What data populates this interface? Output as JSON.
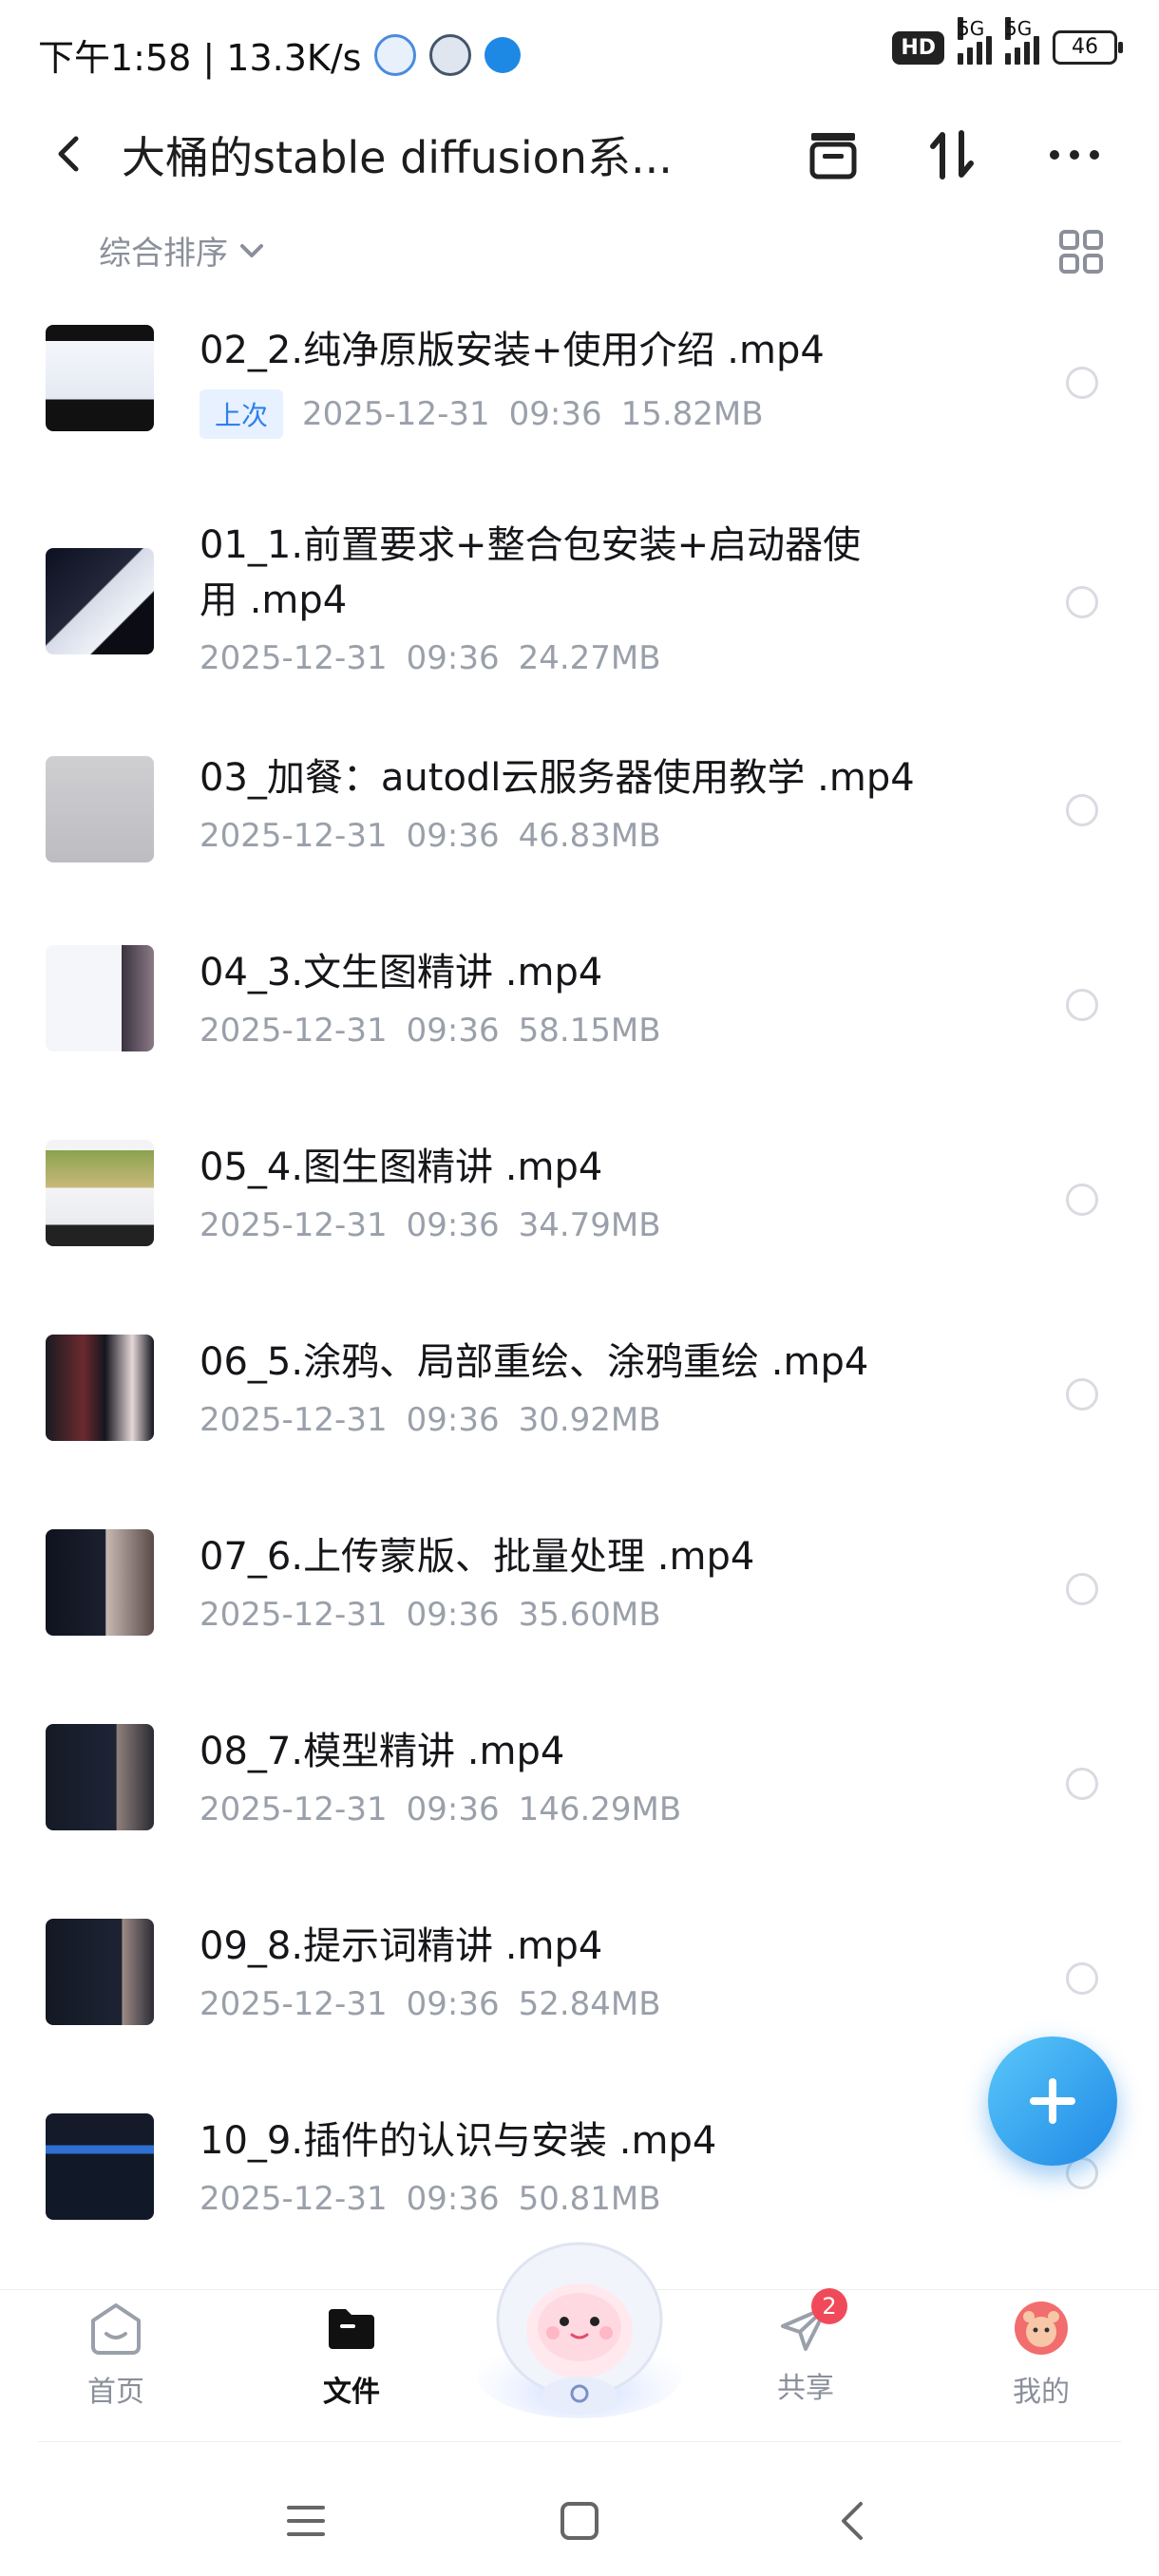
{
  "status_bar": {
    "time_speed": "下午1:58 | 13.3K/s",
    "hd_label": "HD",
    "sim1": "5G",
    "sim2": "5G",
    "battery": "46"
  },
  "header": {
    "title": "大桶的stable diffusion系..."
  },
  "sort": {
    "label": "综合排序"
  },
  "files": [
    {
      "name": "02_2.纯净原版安装+使用介绍 .mp4",
      "tag": "上次",
      "date": "2025-12-31",
      "time": "09:36",
      "size": "15.82MB"
    },
    {
      "name": "01_1.前置要求+整合包安装+启动器使用 .mp4",
      "tag": "",
      "date": "2025-12-31",
      "time": "09:36",
      "size": "24.27MB"
    },
    {
      "name": "03_加餐：autodl云服务器使用教学 .mp4",
      "tag": "",
      "date": "2025-12-31",
      "time": "09:36",
      "size": "46.83MB"
    },
    {
      "name": "04_3.文生图精讲 .mp4",
      "tag": "",
      "date": "2025-12-31",
      "time": "09:36",
      "size": "58.15MB"
    },
    {
      "name": "05_4.图生图精讲 .mp4",
      "tag": "",
      "date": "2025-12-31",
      "time": "09:36",
      "size": "34.79MB"
    },
    {
      "name": "06_5.涂鸦、局部重绘、涂鸦重绘 .mp4",
      "tag": "",
      "date": "2025-12-31",
      "time": "09:36",
      "size": "30.92MB"
    },
    {
      "name": "07_6.上传蒙版、批量处理 .mp4",
      "tag": "",
      "date": "2025-12-31",
      "time": "09:36",
      "size": "35.60MB"
    },
    {
      "name": "08_7.模型精讲 .mp4",
      "tag": "",
      "date": "2025-12-31",
      "time": "09:36",
      "size": "146.29MB"
    },
    {
      "name": "09_8.提示词精讲 .mp4",
      "tag": "",
      "date": "2025-12-31",
      "time": "09:36",
      "size": "52.84MB"
    },
    {
      "name": "10_9.插件的认识与安装 .mp4",
      "tag": "",
      "date": "2025-12-31",
      "time": "09:36",
      "size": "50.81MB"
    }
  ],
  "tabs": {
    "home": "首页",
    "files": "文件",
    "share": "共享",
    "share_badge": "2",
    "mine": "我的"
  },
  "icons": {
    "back": "chevron-left-icon",
    "archive": "archive-icon",
    "sort": "sort-arrows-icon",
    "more": "more-dots-icon",
    "grid": "grid-view-icon",
    "add": "plus-icon"
  },
  "colors": {
    "accent": "#2f80ed",
    "badge": "#f04a5a"
  }
}
